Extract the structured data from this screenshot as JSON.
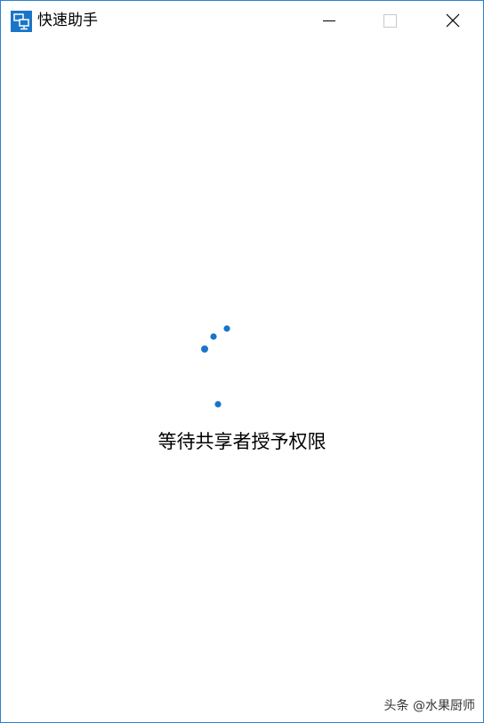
{
  "window": {
    "title": "快速助手",
    "app_icon": "remote-desktop-icon",
    "controls": {
      "minimize_icon": "minimize-icon",
      "maximize_icon": "maximize-icon",
      "close_icon": "close-icon"
    }
  },
  "main": {
    "status_text": "等待共享者授予权限",
    "spinner_icon": "loading-spinner-icon"
  },
  "watermark": {
    "text": "头条 @水果厨师"
  },
  "colors": {
    "accent": "#1a75c8",
    "border": "#2b7fd0"
  }
}
